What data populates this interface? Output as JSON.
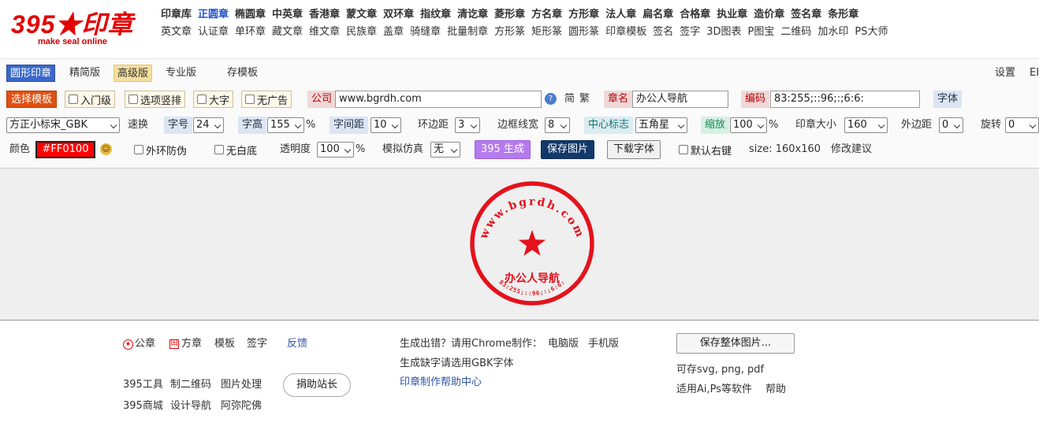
{
  "logo": {
    "title": "395★印章",
    "subtitle": "make seal online"
  },
  "nav": {
    "row1": [
      "印章库",
      "正圆章",
      "椭圆章",
      "中英章",
      "香港章",
      "蒙文章",
      "双环章",
      "指纹章",
      "清讫章",
      "菱形章",
      "方名章",
      "方形章",
      "法人章",
      "扁名章",
      "合格章",
      "执业章",
      "造价章",
      "签名章",
      "条形章"
    ],
    "row2": [
      "英文章",
      "认证章",
      "单环章",
      "藏文章",
      "维文章",
      "民族章",
      "盖章",
      "骑缝章",
      "批量制章",
      "方形篆",
      "矩形篆",
      "圆形篆",
      "印章模板",
      "签名",
      "签字",
      "3D图表",
      "P图宝",
      "二维码",
      "加水印",
      "PS大师"
    ],
    "active": "正圆章"
  },
  "tabs": {
    "round": "圆形印章",
    "simple": "精简版",
    "advanced": "高级版",
    "pro": "专业版",
    "save_template": "存模板",
    "settings": "设置",
    "edge": "EI"
  },
  "row2": {
    "choose_template": "选择模板",
    "beginner": "入门级",
    "options_vertical": "选项竖排",
    "big_font": "大字",
    "no_ads": "无广告",
    "company_label": "公司",
    "company_value": "www.bgrdh.com",
    "help_icon": "?",
    "simplified": "简",
    "traditional": "繁",
    "seal_name_label": "章名",
    "seal_name_value": "办公人导航",
    "code_label": "编码",
    "code_value": "83:255;::96;:;6:6:",
    "font_button": "字体"
  },
  "row3": {
    "font_select": "方正小标宋_GBK",
    "speed_swap": "速换",
    "font_size_label": "字号",
    "font_size": "24",
    "char_height_label": "字高",
    "char_height": "155",
    "pct1": "%",
    "char_spacing_label": "字间距",
    "char_spacing": "10",
    "ring_margin_label": "环边距",
    "ring_margin": "3",
    "border_width_label": "边框线宽",
    "border_width": "8",
    "center_mark_label": "中心标志",
    "center_mark": "五角星",
    "scale_label": "缩放",
    "scale": "100",
    "pct2": "%",
    "seal_size_label": "印章大小",
    "seal_size": "160",
    "outer_margin_label": "外边距",
    "outer_margin": "0",
    "rotate_label": "旋转",
    "rotate": "0"
  },
  "row4": {
    "color_label": "颜色",
    "color_value": "#FF0100",
    "outer_anti_fake": "外环防伪",
    "no_white_bg": "无白底",
    "opacity_label": "透明度",
    "opacity": "100",
    "pct": "%",
    "simulate_label": "模拟仿真",
    "simulate": "无",
    "generate": "395 生成",
    "save_image": "保存图片",
    "download_font": "下载字体",
    "default_right_click": "默认右键",
    "size_text": "size: 160x160",
    "suggest": "修改建议"
  },
  "seal": {
    "outer_text": "www.bgrdh.com",
    "center_text": "办公人导航",
    "code_text": "83:255;::96;:;6:6:",
    "color": "#e4121d"
  },
  "footer": {
    "official_seal": "公章",
    "square_seal": "方章",
    "template": "模板",
    "signature": "签字",
    "feedback": "反馈",
    "tools": "395工具",
    "qrcode": "制二维码",
    "image_proc": "图片处理",
    "donate": "捐助站长",
    "mall": "395商城",
    "design_nav": "设计导航",
    "amitabha": "阿弥陀佛",
    "error_text": "生成出错？请用Chrome制作：",
    "desktop": "电脑版",
    "mobile": "手机版",
    "gbk_text": "生成缺字请选用GBK字体",
    "help_center": "印章制作帮助中心",
    "save_whole": "保存整体图片...",
    "formats": "可存svg, png, pdf",
    "software": "适用Ai,Ps等软件",
    "help": "帮助"
  }
}
